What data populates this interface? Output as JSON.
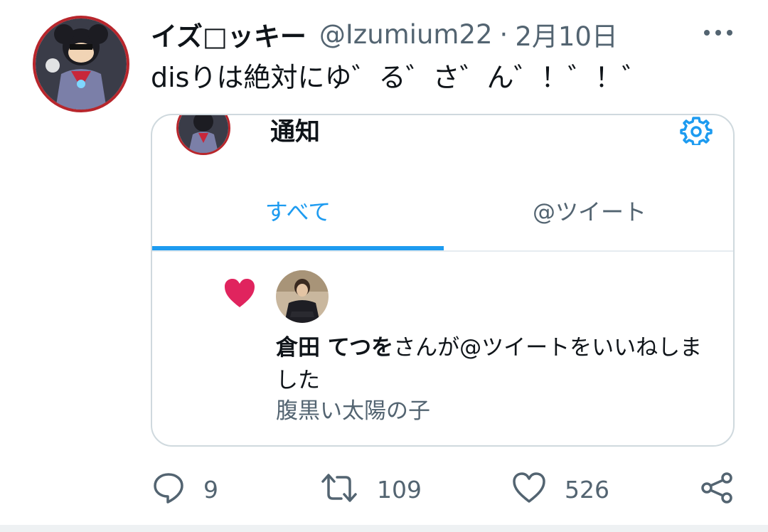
{
  "tweet": {
    "display_name": "イズ□ッキー",
    "handle": "@Izumium22",
    "separator": "·",
    "time": "2月10日",
    "text": "disりは絶対にゆ゛る゛さ゛ん゛！゛！゛"
  },
  "card": {
    "title": "通知",
    "tabs": [
      {
        "label": "すべて",
        "active": true
      },
      {
        "label": "@ツイート",
        "active": false
      }
    ],
    "notification": {
      "user_name": "倉田 てつを",
      "action_text": "さんが@ツイートをいいねしました",
      "tweet_text": "腹黒い太陽の子"
    }
  },
  "actions": {
    "reply_count": "9",
    "retweet_count": "109",
    "like_count": "526"
  },
  "colors": {
    "accent": "#1d9bf0",
    "like_red": "#e0245e",
    "muted": "#536471"
  },
  "icons": [
    "more-icon",
    "gear-icon",
    "heart-icon",
    "reply-icon",
    "retweet-icon",
    "like-icon",
    "share-icon"
  ]
}
